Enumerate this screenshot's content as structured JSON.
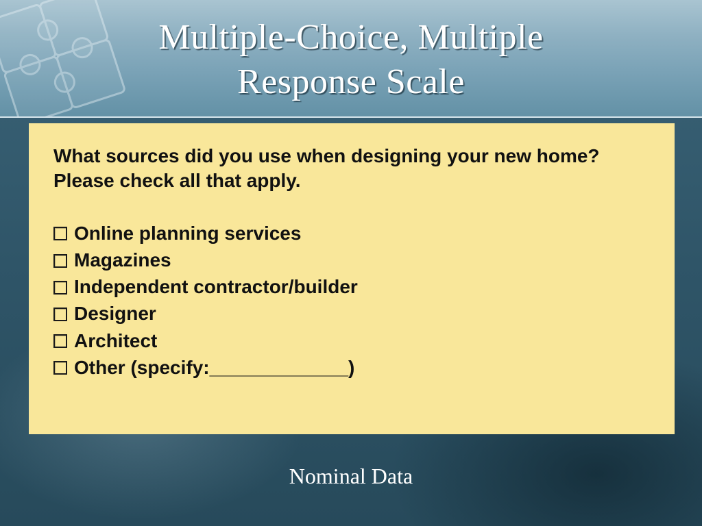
{
  "header": {
    "title_line1": "Multiple-Choice, Multiple",
    "title_line2": "Response Scale"
  },
  "panel": {
    "question": "What sources did you use when designing your new home? Please check all that apply.",
    "options": [
      "Online planning services",
      "Magazines",
      "Independent contractor/builder",
      "Designer",
      "Architect",
      "Other (specify:_____________)"
    ]
  },
  "footer": {
    "label": "Nominal Data"
  }
}
